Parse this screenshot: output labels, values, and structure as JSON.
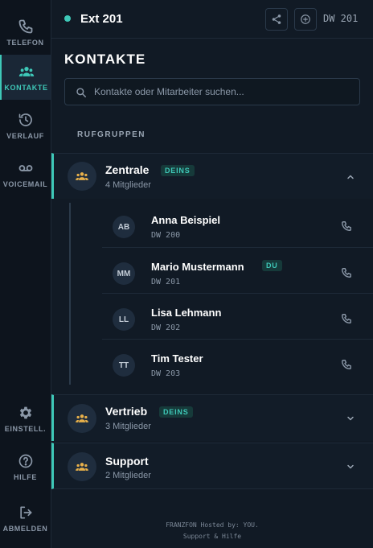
{
  "nav": {
    "phone": "TELEFON",
    "contacts": "KONTAKTE",
    "history": "VERLAUF",
    "voicemail": "VOICEMAIL",
    "settings": "EINSTELL.",
    "help": "HILFE",
    "logout": "ABMELDEN"
  },
  "topbar": {
    "extension": "Ext 201",
    "dw": "DW 201"
  },
  "page": {
    "title": "KONTAKTE",
    "search_placeholder": "Kontakte oder Mitarbeiter suchen...",
    "section": "RUFGRUPPEN"
  },
  "groups": [
    {
      "name": "Zentrale",
      "badge": "DEINS",
      "count": "4 Mitglieder",
      "expanded": true
    },
    {
      "name": "Vertrieb",
      "badge": "DEINS",
      "count": "3 Mitglieder",
      "expanded": false
    },
    {
      "name": "Support",
      "badge": "",
      "count": "2 Mitglieder",
      "expanded": false
    }
  ],
  "members": [
    {
      "initials": "AB",
      "name": "Anna Beispiel",
      "ext": "DW 200",
      "badge": ""
    },
    {
      "initials": "MM",
      "name": "Mario Mustermann",
      "ext": "DW 201",
      "badge": "DU"
    },
    {
      "initials": "LL",
      "name": "Lisa Lehmann",
      "ext": "DW 202",
      "badge": ""
    },
    {
      "initials": "TT",
      "name": "Tim Tester",
      "ext": "DW 203",
      "badge": ""
    }
  ],
  "footer": {
    "line1": "FRANZFON Hosted by: YOU.",
    "line2": "Support & Hilfe"
  },
  "colors": {
    "accent": "#3ec8b8",
    "group_icon": "#e8b04a",
    "background": "#111a25"
  }
}
